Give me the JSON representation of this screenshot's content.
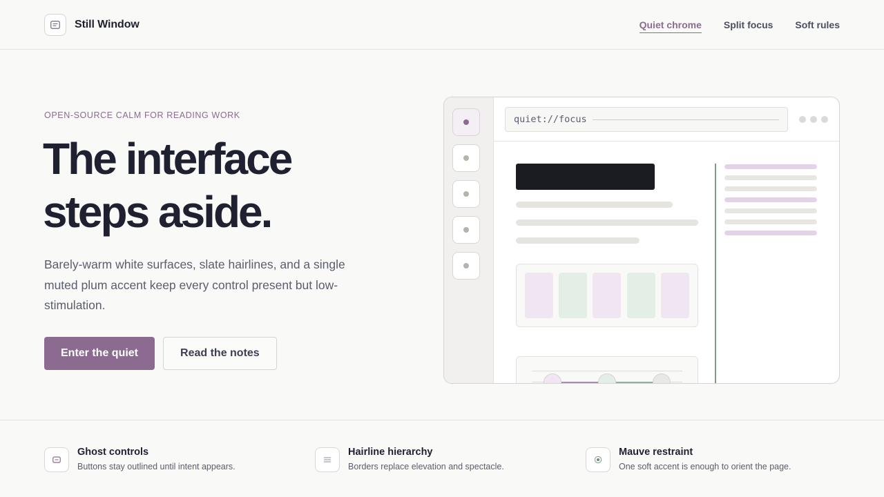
{
  "brand": {
    "name": "Still Window",
    "icon": "window-icon"
  },
  "nav": {
    "items": [
      {
        "label": "Quiet chrome",
        "active": true
      },
      {
        "label": "Split focus",
        "active": false
      },
      {
        "label": "Soft rules",
        "active": false
      }
    ]
  },
  "hero": {
    "eyebrow": "OPEN-SOURCE CALM FOR READING WORK",
    "headline_line1": "The interface",
    "headline_line2": "steps aside.",
    "lede": "Barely-warm white surfaces, slate hairlines, and a single muted plum accent keep every control present but low-stimulation.",
    "primary_cta": "Enter the quiet",
    "secondary_cta": "Read the notes"
  },
  "mock_window": {
    "address": "quiet://focus",
    "rail_item_count": 5,
    "active_rail_item": 1
  },
  "features": [
    {
      "title": "Ghost controls",
      "description": "Buttons stay outlined until intent appears.",
      "icon": "ghost-button-icon"
    },
    {
      "title": "Hairline hierarchy",
      "description": "Borders replace elevation and spectacle.",
      "icon": "lines-icon"
    },
    {
      "title": "Mauve restraint",
      "description": "One soft accent is enough to orient the page.",
      "icon": "target-dot-icon"
    }
  ],
  "colors": {
    "accent": "#8b6b90",
    "ink": "#1f2130",
    "surface": "#f9f9f7",
    "hairline": "#e4e3e0",
    "sage": "#7e9d88",
    "plum_tint": "#efe6f1",
    "sage_tint": "#e3efe6"
  }
}
